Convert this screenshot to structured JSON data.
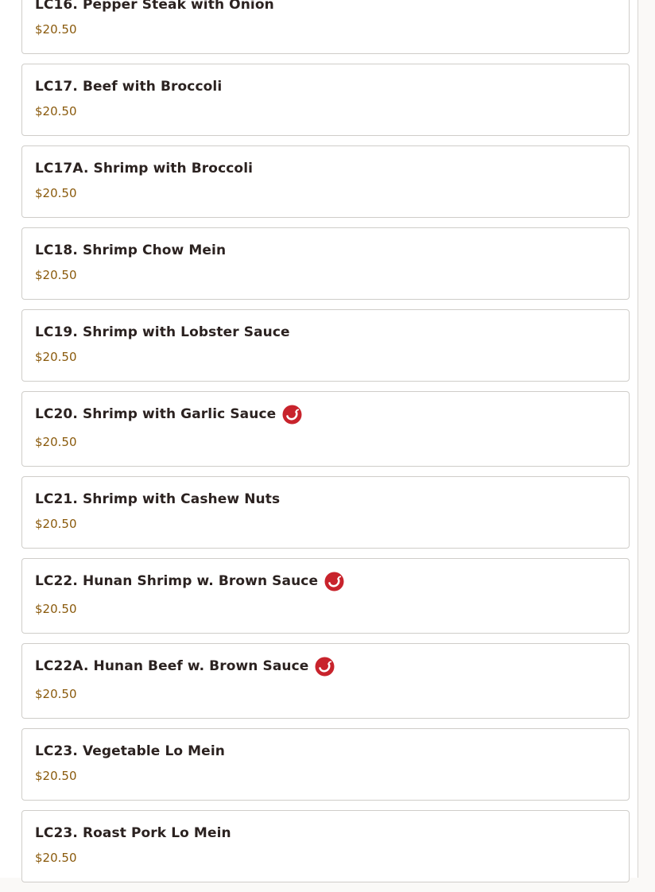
{
  "colors": {
    "spicy_icon": "#c8232c",
    "price_text": "#8a5a0c",
    "title_text": "#2b2220"
  },
  "menu": {
    "items": [
      {
        "name": "LC16. Pepper Steak with Onion",
        "price": "$20.50",
        "spicy": false
      },
      {
        "name": "LC17. Beef with Broccoli",
        "price": "$20.50",
        "spicy": false
      },
      {
        "name": "LC17A. Shrimp with Broccoli",
        "price": "$20.50",
        "spicy": false
      },
      {
        "name": "LC18. Shrimp Chow Mein",
        "price": "$20.50",
        "spicy": false
      },
      {
        "name": "LC19. Shrimp with Lobster Sauce",
        "price": "$20.50",
        "spicy": false
      },
      {
        "name": "LC20. Shrimp with Garlic Sauce",
        "price": "$20.50",
        "spicy": true
      },
      {
        "name": "LC21. Shrimp with Cashew Nuts",
        "price": "$20.50",
        "spicy": false
      },
      {
        "name": "LC22. Hunan Shrimp w. Brown Sauce",
        "price": "$20.50",
        "spicy": true
      },
      {
        "name": "LC22A. Hunan Beef w. Brown Sauce",
        "price": "$20.50",
        "spicy": true
      },
      {
        "name": "LC23. Vegetable Lo Mein",
        "price": "$20.50",
        "spicy": false
      },
      {
        "name": "LC23. Roast Pork Lo Mein",
        "price": "$20.50",
        "spicy": false
      }
    ],
    "spicy_icon_name": "chili-pepper-icon"
  }
}
